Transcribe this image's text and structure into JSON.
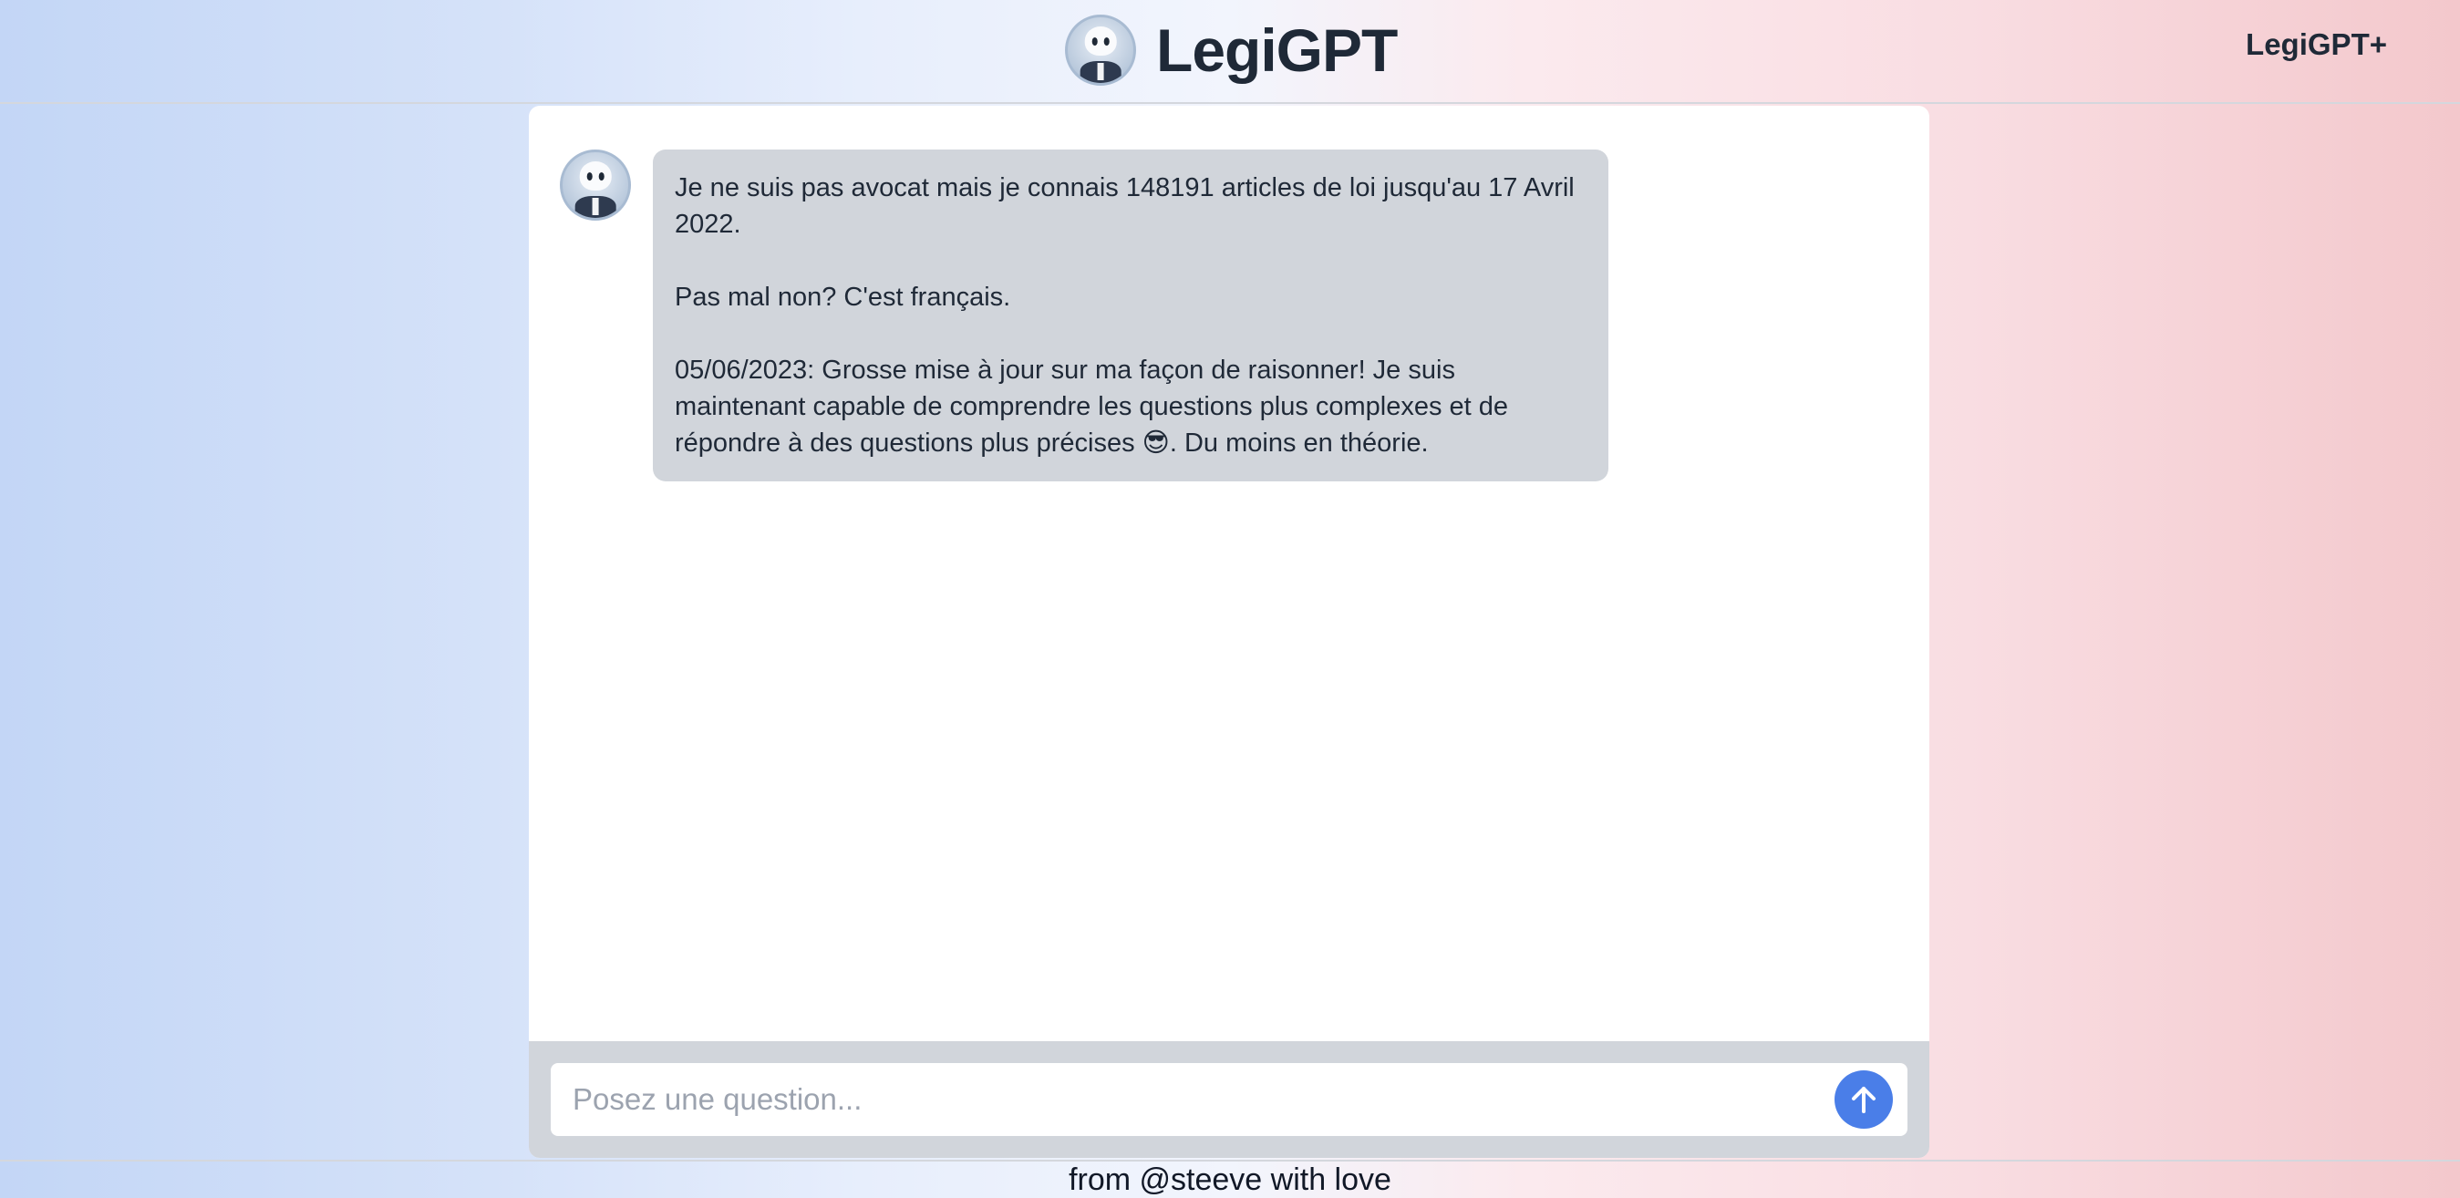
{
  "header": {
    "title": "LegiGPT",
    "plus_link": "LegiGPT+",
    "logo_icon": "robot-lawyer-avatar"
  },
  "chat": {
    "messages": [
      {
        "role": "assistant",
        "avatar_icon": "robot-lawyer-avatar",
        "paragraphs": [
          "Je ne suis pas avocat mais je connais 148191 articles de loi jusqu'au 17 Avril 2022.",
          "Pas mal non? C'est français.",
          "05/06/2023: Grosse mise à jour sur ma façon de raisonner! Je suis maintenant capable de comprendre les questions plus complexes et de répondre à des questions plus précises 😎. Du moins en théorie."
        ]
      }
    ]
  },
  "input": {
    "placeholder": "Posez une question...",
    "value": "",
    "send_icon": "arrow-up-icon"
  },
  "footer": {
    "text": "from @steeve with love"
  },
  "colors": {
    "accent": "#4a7ee8",
    "bubble_bg": "#d1d5db",
    "gradient_left": "#c3d6f6",
    "gradient_right": "#f3c8cc"
  }
}
